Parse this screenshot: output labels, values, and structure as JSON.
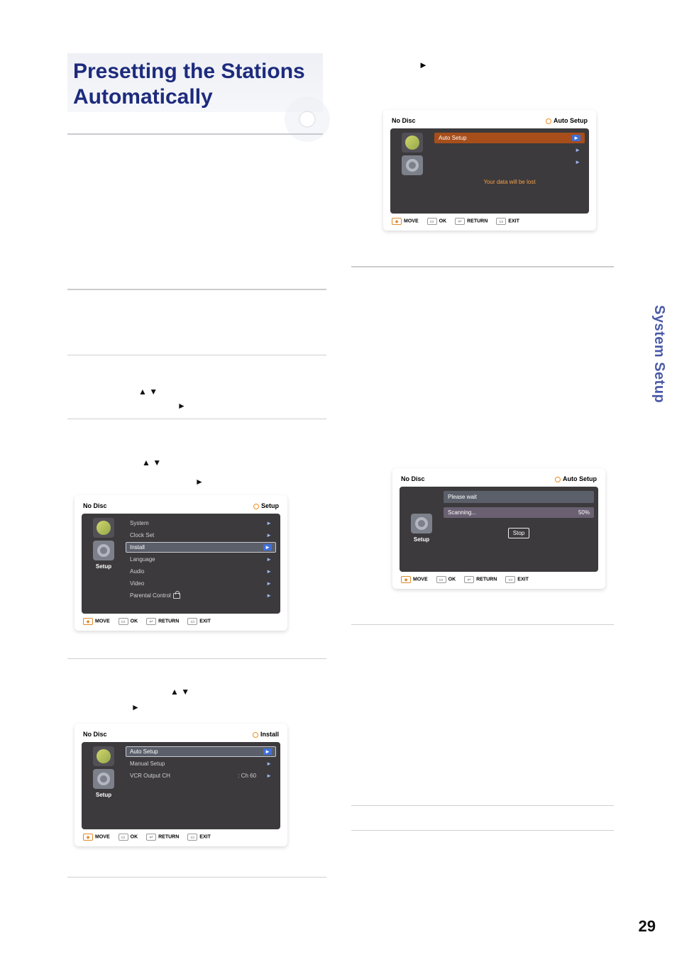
{
  "page": {
    "title_line1": "Presetting the Stations",
    "title_line2": "Automatically",
    "side_tab": "System Setup",
    "number": "29"
  },
  "glyphs": {
    "up": "▲",
    "down": "▼",
    "right": "►",
    "circle": "○"
  },
  "footer_keys": {
    "move": "MOVE",
    "ok": "OK",
    "return": "RETURN",
    "exit": "EXIT"
  },
  "top_arrow_note": "►",
  "step2_frag": "▲ ▼",
  "step2_frag_r": "►",
  "step3_frag": "▲ ▼",
  "step3_frag_r": "►",
  "step4_frag": "▲ ▼",
  "step4_frag_r": "►",
  "osd_setup": {
    "status": "No Disc",
    "crumb": "Setup",
    "side_label": "Setup",
    "items": [
      {
        "label": "System"
      },
      {
        "label": "Clock Set"
      },
      {
        "label": "Install"
      },
      {
        "label": "Language"
      },
      {
        "label": "Audio"
      },
      {
        "label": "Video"
      },
      {
        "label": "Parental Control"
      }
    ]
  },
  "osd_install": {
    "status": "No Disc",
    "crumb": "Install",
    "side_label": "Setup",
    "items": [
      {
        "label": "Auto Setup",
        "value": ""
      },
      {
        "label": "Manual Setup",
        "value": ""
      },
      {
        "label": "VCR Output CH",
        "value": ": Ch 60"
      }
    ]
  },
  "osd_autosetup": {
    "status": "No Disc",
    "crumb": "Auto Setup",
    "warning": "Your data will be lost",
    "items": [
      {
        "label": "Auto Setup"
      }
    ]
  },
  "osd_scan": {
    "status": "No Disc",
    "crumb": "Auto Setup",
    "side_label": "Setup",
    "wait": "Please wait",
    "scanning": "Scanning...",
    "progress": "50%",
    "stop": "Stop"
  }
}
